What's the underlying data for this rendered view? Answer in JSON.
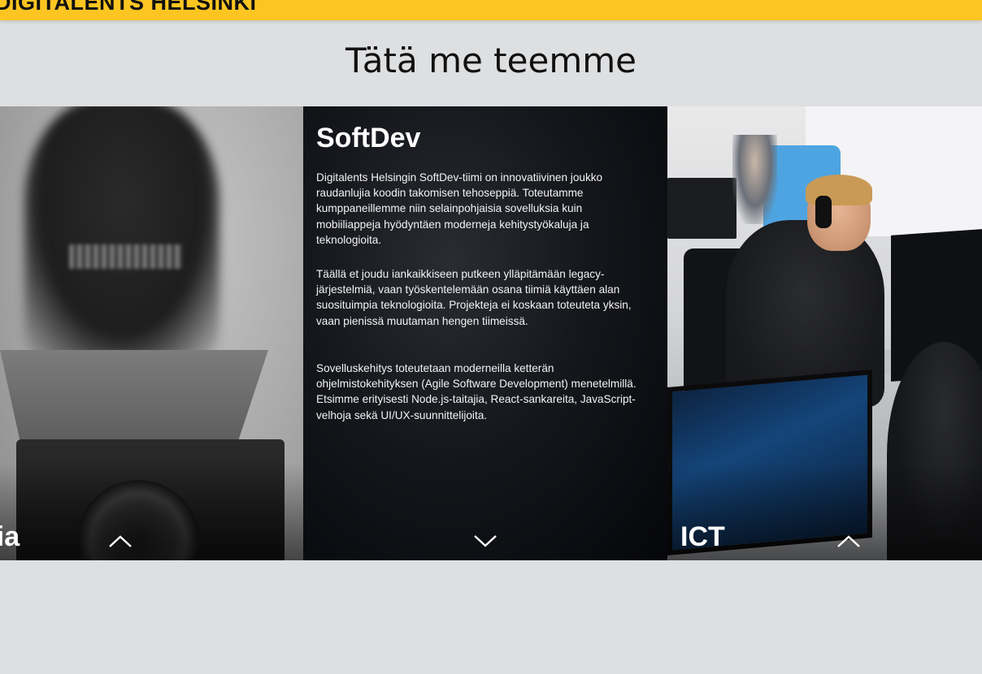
{
  "header": {
    "brand": "DIGITALENTS HELSINKI",
    "bar_color": "#fcc521"
  },
  "section": {
    "title": "Tätä me teemme"
  },
  "cards": [
    {
      "id": "media",
      "label": "Media",
      "visible_label": "dia",
      "expanded": false,
      "toggle_icon": "chevron-up-icon"
    },
    {
      "id": "softdev",
      "label": "SoftDev",
      "expanded": true,
      "toggle_icon": "chevron-down-icon",
      "paragraphs": [
        "Digitalents Helsingin SoftDev-tiimi on innovatiivinen joukko raudanlujia koodin takomisen tehoseppiä. Toteutamme kumppaneillemme niin selainpohjaisia sovelluksia kuin mobiiliappeja hyödyntäen moderneja kehitystyökaluja ja teknologioita.",
        "Täällä et joudu iankaikkiseen putkeen ylläpitämään legacy-järjestelmiä, vaan työskentelemään osana tiimiä käyttäen alan suosituimpia teknologioita. Projekteja ei koskaan toteuteta yksin, vaan pienissä muutaman hengen tiimeissä.",
        "Sovelluskehitys toteutetaan moderneilla ketterän ohjelmistokehityksen (Agile Software Development) menetelmillä. Etsimme erityisesti Node.js-taitajia, React-sankareita, JavaScript-velhoja sekä UI/UX-suunnittelijoita."
      ]
    },
    {
      "id": "ict",
      "label": "ICT",
      "expanded": false,
      "toggle_icon": "chevron-up-icon"
    }
  ]
}
